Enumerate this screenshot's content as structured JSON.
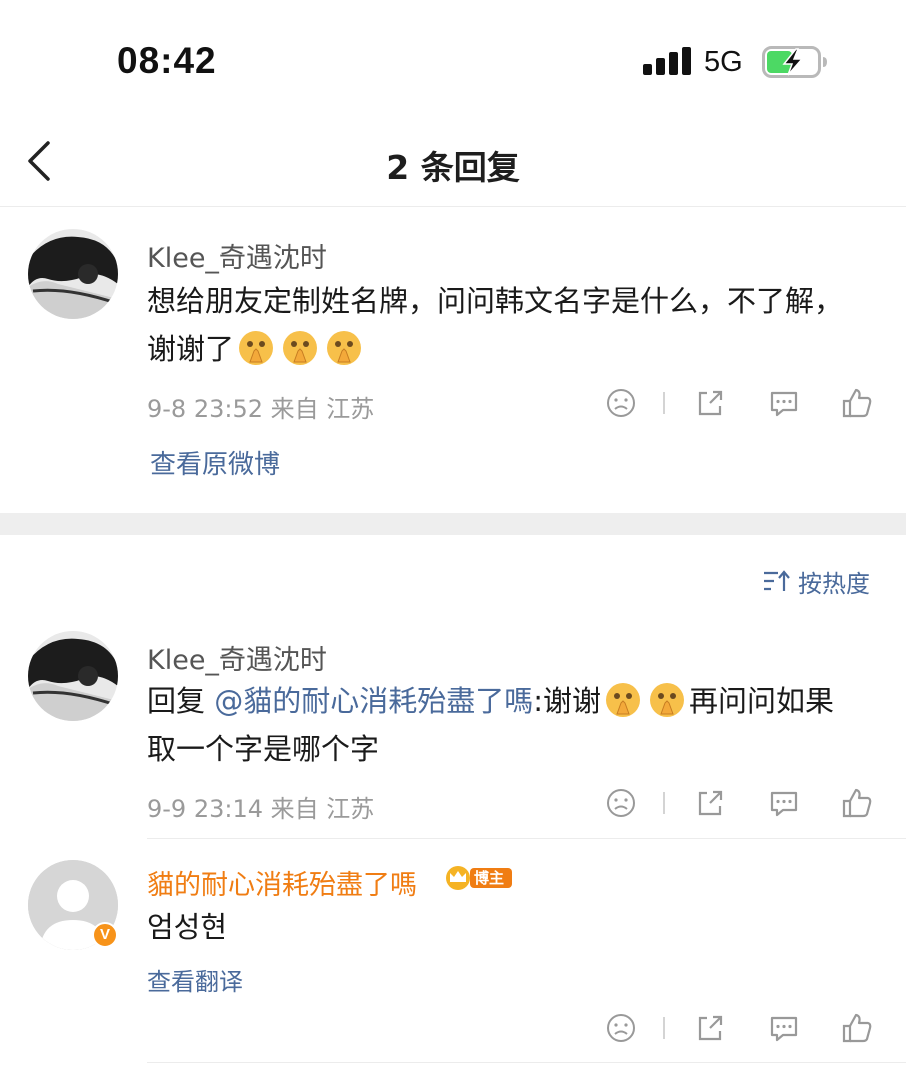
{
  "status_bar": {
    "time": "08:42",
    "network": "5G"
  },
  "nav": {
    "title": "2 条回复",
    "back_icon": "chevron-left-icon"
  },
  "original_comment": {
    "username": "Klee_奇遇沈时",
    "text": "想给朋友定制姓名牌，问问韩文名字是什么，不了解，谢谢了",
    "emoji_count": 3,
    "emoji_icon": "pray-face-emoji",
    "meta": "9-8 23:52  来自 江苏",
    "view_original": "查看原微博"
  },
  "sort": {
    "label": "按热度",
    "icon": "sort-icon"
  },
  "replies": [
    {
      "username": "Klee_奇遇沈时",
      "prefix": "回复 ",
      "mention": "@貓的耐心消耗殆盡了嗎",
      "text_a": ":谢谢",
      "text_b": "再问问如果取一个字是哪个字",
      "meta": "9-9 23:14  来自 江苏"
    },
    {
      "username": "貓的耐心消耗殆盡了嗎",
      "badge_label": "博主",
      "verified_label": "V",
      "text": "엄성현",
      "translate": "查看翻译"
    }
  ],
  "action_icons": [
    "dislike-icon",
    "share-icon",
    "comment-icon",
    "like-icon"
  ],
  "colors": {
    "link": "#4a6a9b",
    "author": "#f07d13",
    "battery": "#4cd964"
  }
}
